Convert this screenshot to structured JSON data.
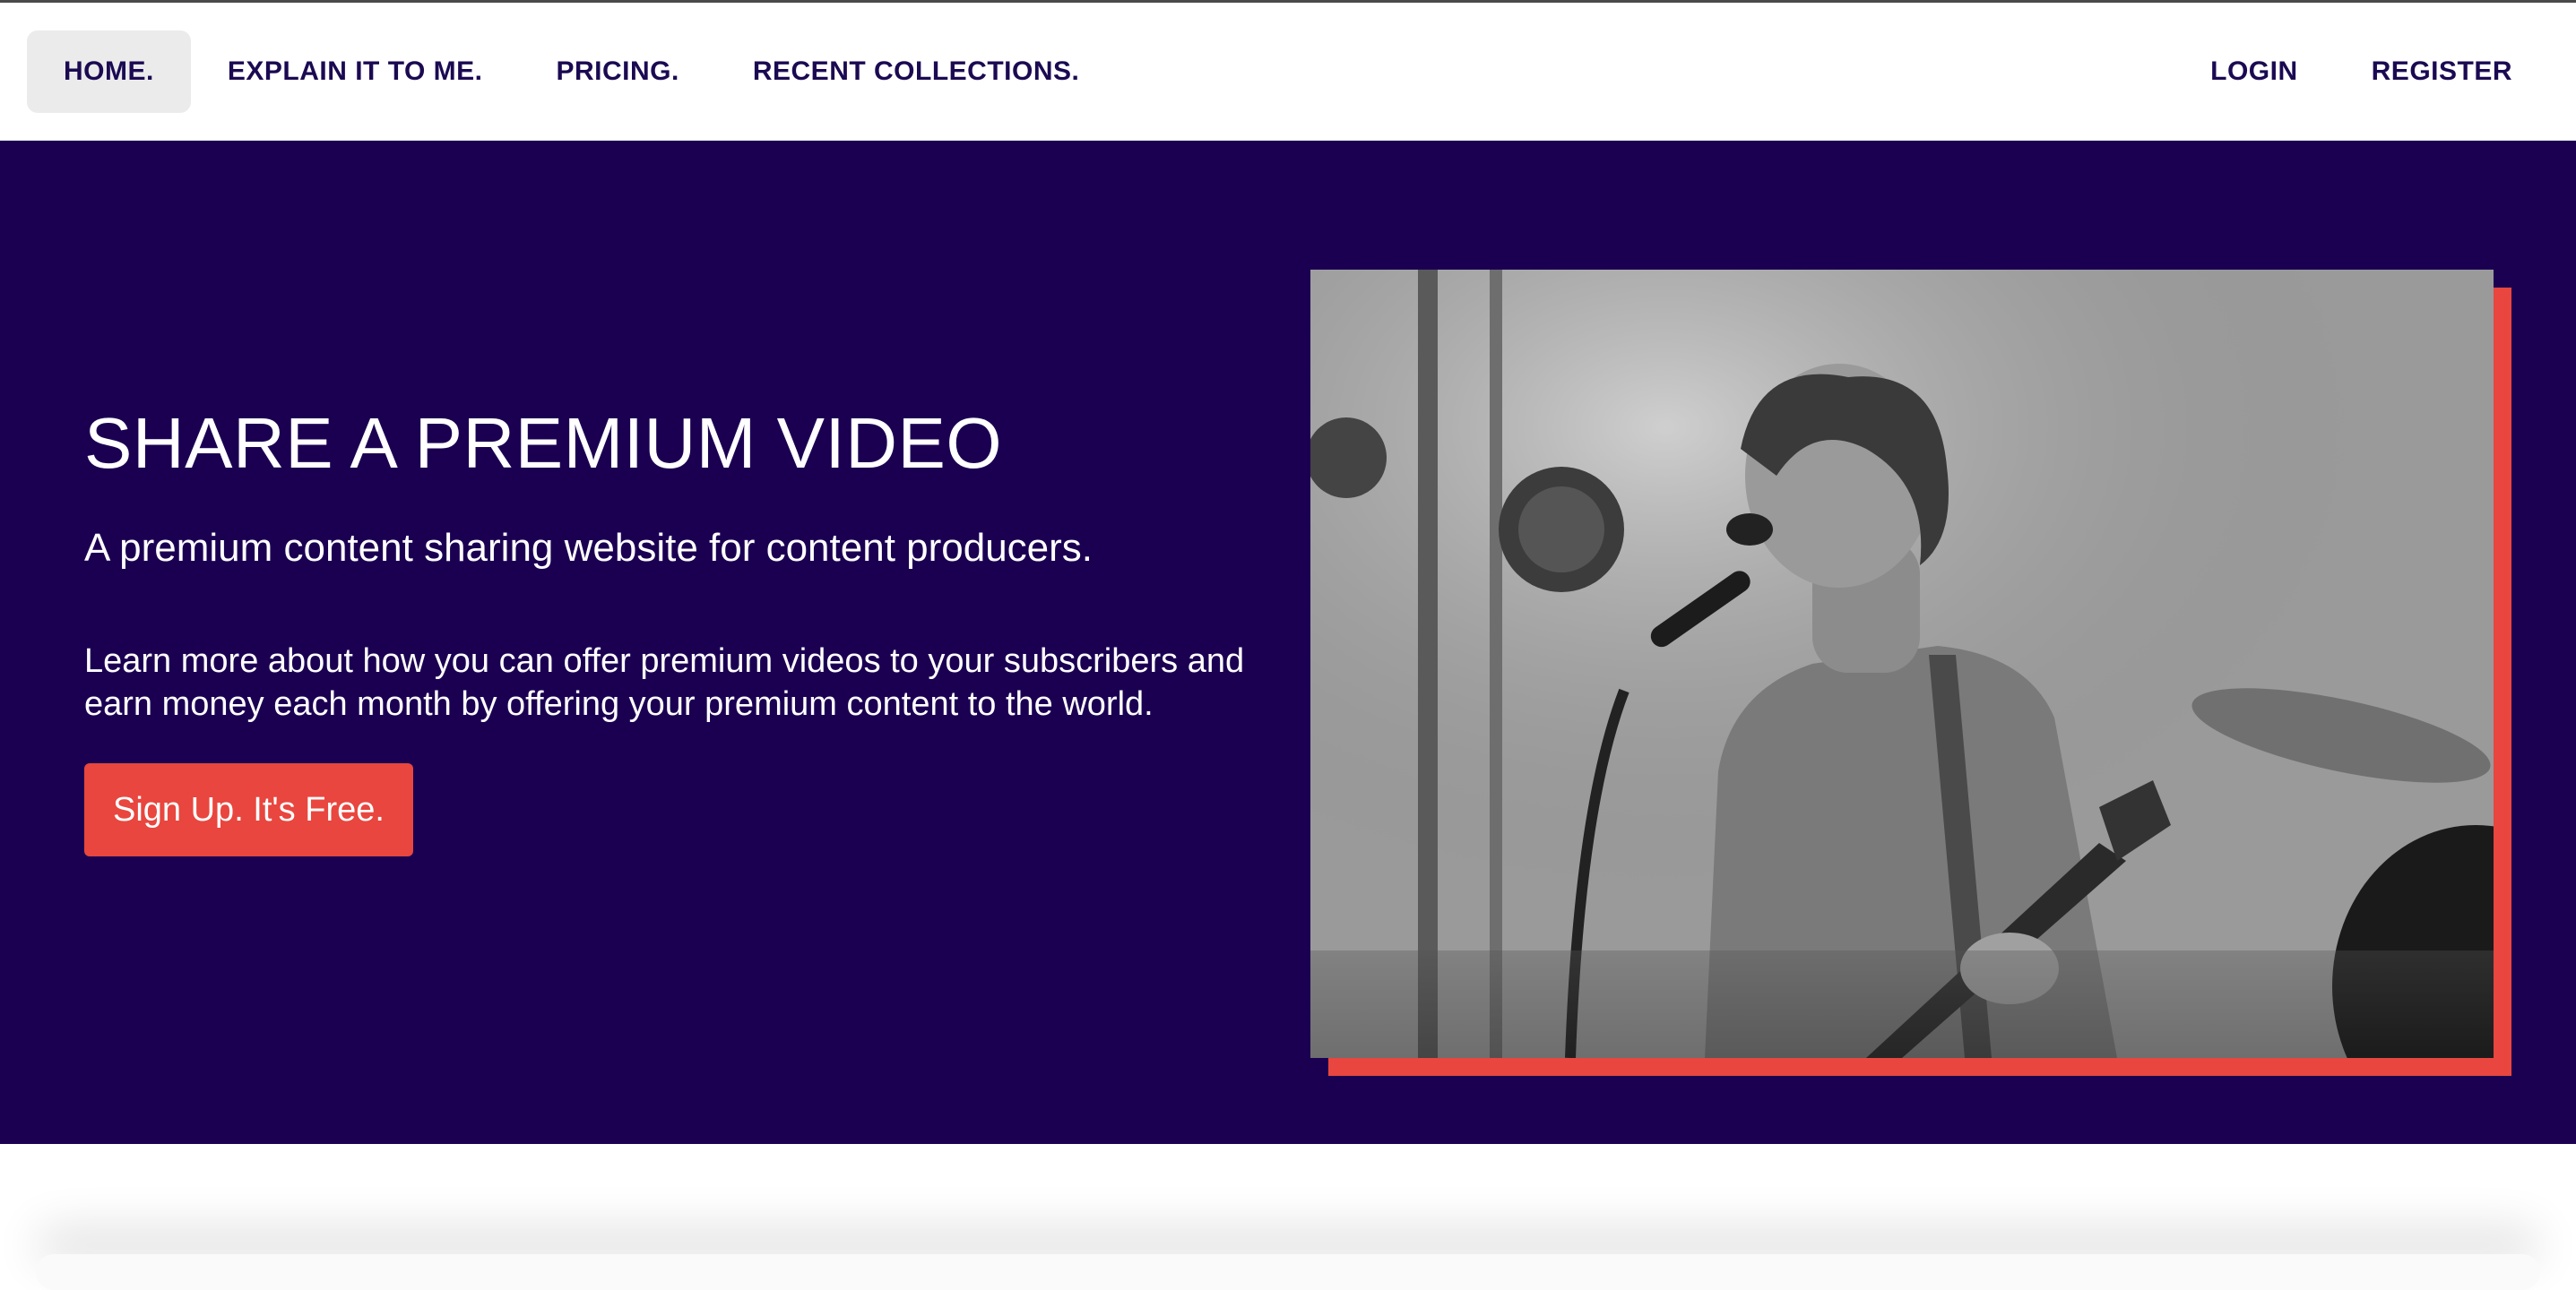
{
  "nav": {
    "left": [
      {
        "label": "HOME.",
        "active": true
      },
      {
        "label": "EXPLAIN IT TO ME."
      },
      {
        "label": "PRICING."
      },
      {
        "label": "RECENT COLLECTIONS."
      }
    ],
    "right": [
      {
        "label": "LOGIN"
      },
      {
        "label": "REGISTER"
      }
    ]
  },
  "hero": {
    "title": "SHARE A PREMIUM VIDEO",
    "subtitle": "A premium content sharing website for content producers.",
    "description": "Learn more about how you can offer premium videos to your subscribers and earn money each month by offering your premium content to the world.",
    "cta_label": "Sign Up. It's Free."
  },
  "colors": {
    "hero_background": "#1b0052",
    "accent": "#e8463e",
    "nav_text": "#1b0a52",
    "nav_active_bg": "#ebebeb"
  },
  "icons": {
    "hero_image": "singer-with-guitar-photo"
  }
}
